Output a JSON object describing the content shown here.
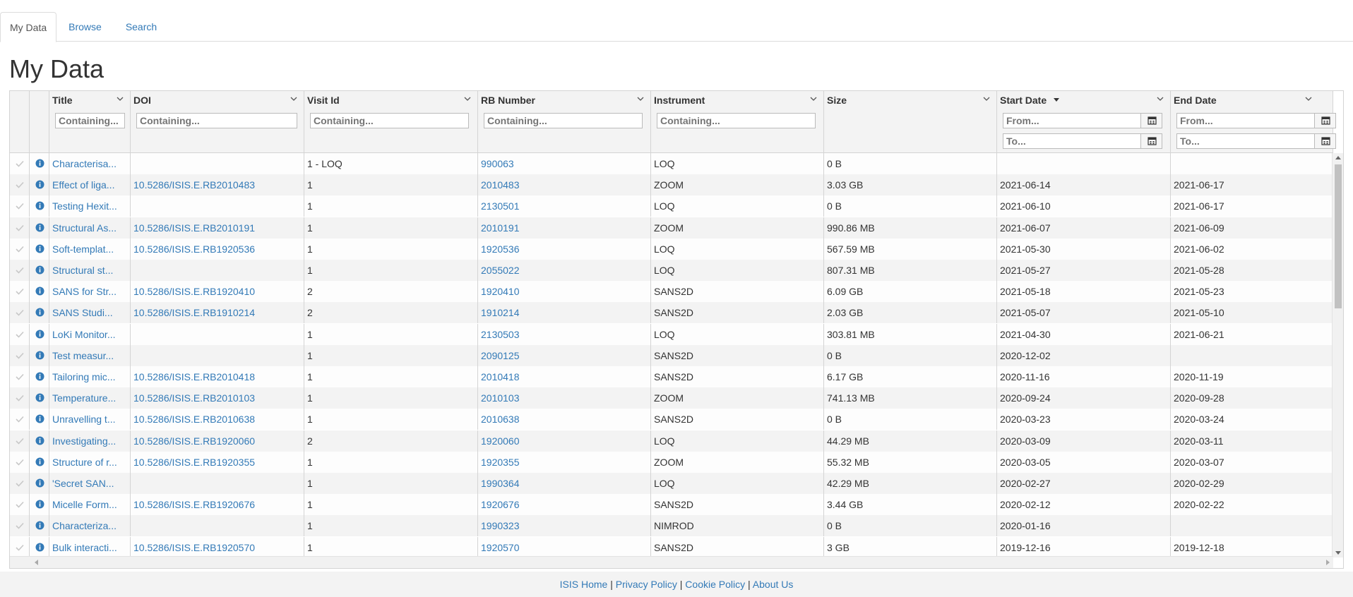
{
  "tabs": [
    {
      "label": "My Data",
      "active": true
    },
    {
      "label": "Browse",
      "active": false
    },
    {
      "label": "Search",
      "active": false
    }
  ],
  "page_title": "My Data",
  "columns": {
    "title": {
      "label": "Title",
      "placeholder": "Containing..."
    },
    "doi": {
      "label": "DOI",
      "placeholder": "Containing..."
    },
    "visit_id": {
      "label": "Visit Id",
      "placeholder": "Containing..."
    },
    "rb_number": {
      "label": "RB Number",
      "placeholder": "Containing..."
    },
    "instrument": {
      "label": "Instrument",
      "placeholder": "Containing..."
    },
    "size": {
      "label": "Size"
    },
    "start_date": {
      "label": "Start Date",
      "from_placeholder": "From...",
      "to_placeholder": "To...",
      "sorted": "descending"
    },
    "end_date": {
      "label": "End Date",
      "from_placeholder": "From...",
      "to_placeholder": "To..."
    }
  },
  "rows": [
    {
      "title": "Characterisa...",
      "doi": "",
      "visit_id": "1 - LOQ",
      "rb_number": "990063",
      "instrument": "LOQ",
      "size": "0 B",
      "start_date": "",
      "end_date": ""
    },
    {
      "title": "Effect of liga...",
      "doi": "10.5286/ISIS.E.RB2010483",
      "visit_id": "1",
      "rb_number": "2010483",
      "instrument": "ZOOM",
      "size": "3.03 GB",
      "start_date": "2021-06-14",
      "end_date": "2021-06-17"
    },
    {
      "title": "Testing Hexit...",
      "doi": "",
      "visit_id": "1",
      "rb_number": "2130501",
      "instrument": "LOQ",
      "size": "0 B",
      "start_date": "2021-06-10",
      "end_date": "2021-06-17"
    },
    {
      "title": "Structural As...",
      "doi": "10.5286/ISIS.E.RB2010191",
      "visit_id": "1",
      "rb_number": "2010191",
      "instrument": "ZOOM",
      "size": "990.86 MB",
      "start_date": "2021-06-07",
      "end_date": "2021-06-09"
    },
    {
      "title": "Soft-templat...",
      "doi": "10.5286/ISIS.E.RB1920536",
      "visit_id": "1",
      "rb_number": "1920536",
      "instrument": "LOQ",
      "size": "567.59 MB",
      "start_date": "2021-05-30",
      "end_date": "2021-06-02"
    },
    {
      "title": "Structural st...",
      "doi": "",
      "visit_id": "1",
      "rb_number": "2055022",
      "instrument": "LOQ",
      "size": "807.31 MB",
      "start_date": "2021-05-27",
      "end_date": "2021-05-28"
    },
    {
      "title": "SANS for Str...",
      "doi": "10.5286/ISIS.E.RB1920410",
      "visit_id": "2",
      "rb_number": "1920410",
      "instrument": "SANS2D",
      "size": "6.09 GB",
      "start_date": "2021-05-18",
      "end_date": "2021-05-23"
    },
    {
      "title": "SANS Studi...",
      "doi": "10.5286/ISIS.E.RB1910214",
      "visit_id": "2",
      "rb_number": "1910214",
      "instrument": "SANS2D",
      "size": "2.03 GB",
      "start_date": "2021-05-07",
      "end_date": "2021-05-10"
    },
    {
      "title": "LoKi Monitor...",
      "doi": "",
      "visit_id": "1",
      "rb_number": "2130503",
      "instrument": "LOQ",
      "size": "303.81 MB",
      "start_date": "2021-04-30",
      "end_date": "2021-06-21"
    },
    {
      "title": "Test measur...",
      "doi": "",
      "visit_id": "1",
      "rb_number": "2090125",
      "instrument": "SANS2D",
      "size": "0 B",
      "start_date": "2020-12-02",
      "end_date": ""
    },
    {
      "title": "Tailoring mic...",
      "doi": "10.5286/ISIS.E.RB2010418",
      "visit_id": "1",
      "rb_number": "2010418",
      "instrument": "SANS2D",
      "size": "6.17 GB",
      "start_date": "2020-11-16",
      "end_date": "2020-11-19"
    },
    {
      "title": "Temperature...",
      "doi": "10.5286/ISIS.E.RB2010103",
      "visit_id": "1",
      "rb_number": "2010103",
      "instrument": "ZOOM",
      "size": "741.13 MB",
      "start_date": "2020-09-24",
      "end_date": "2020-09-28"
    },
    {
      "title": "Unravelling t...",
      "doi": "10.5286/ISIS.E.RB2010638",
      "visit_id": "1",
      "rb_number": "2010638",
      "instrument": "SANS2D",
      "size": "0 B",
      "start_date": "2020-03-23",
      "end_date": "2020-03-24"
    },
    {
      "title": "Investigating...",
      "doi": "10.5286/ISIS.E.RB1920060",
      "visit_id": "2",
      "rb_number": "1920060",
      "instrument": "LOQ",
      "size": "44.29 MB",
      "start_date": "2020-03-09",
      "end_date": "2020-03-11"
    },
    {
      "title": "Structure of r...",
      "doi": "10.5286/ISIS.E.RB1920355",
      "visit_id": "1",
      "rb_number": "1920355",
      "instrument": "ZOOM",
      "size": "55.32 MB",
      "start_date": "2020-03-05",
      "end_date": "2020-03-07"
    },
    {
      "title": "'Secret SAN...",
      "doi": "",
      "visit_id": "1",
      "rb_number": "1990364",
      "instrument": "LOQ",
      "size": "42.29 MB",
      "start_date": "2020-02-27",
      "end_date": "2020-02-29"
    },
    {
      "title": "Micelle Form...",
      "doi": "10.5286/ISIS.E.RB1920676",
      "visit_id": "1",
      "rb_number": "1920676",
      "instrument": "SANS2D",
      "size": "3.44 GB",
      "start_date": "2020-02-12",
      "end_date": "2020-02-22"
    },
    {
      "title": "Characteriza...",
      "doi": "",
      "visit_id": "1",
      "rb_number": "1990323",
      "instrument": "NIMROD",
      "size": "0 B",
      "start_date": "2020-01-16",
      "end_date": ""
    },
    {
      "title": "Bulk interacti...",
      "doi": "10.5286/ISIS.E.RB1920570",
      "visit_id": "1",
      "rb_number": "1920570",
      "instrument": "SANS2D",
      "size": "3 GB",
      "start_date": "2019-12-16",
      "end_date": "2019-12-18"
    }
  ],
  "footer": {
    "links": [
      "ISIS Home",
      "Privacy Policy",
      "Cookie Policy",
      "About Us"
    ],
    "separator": "|"
  },
  "colors": {
    "link": "#337ab7",
    "header_bg": "#f3f3f3",
    "row_alt": "#f3f3f3",
    "border": "#d4d4d4"
  }
}
